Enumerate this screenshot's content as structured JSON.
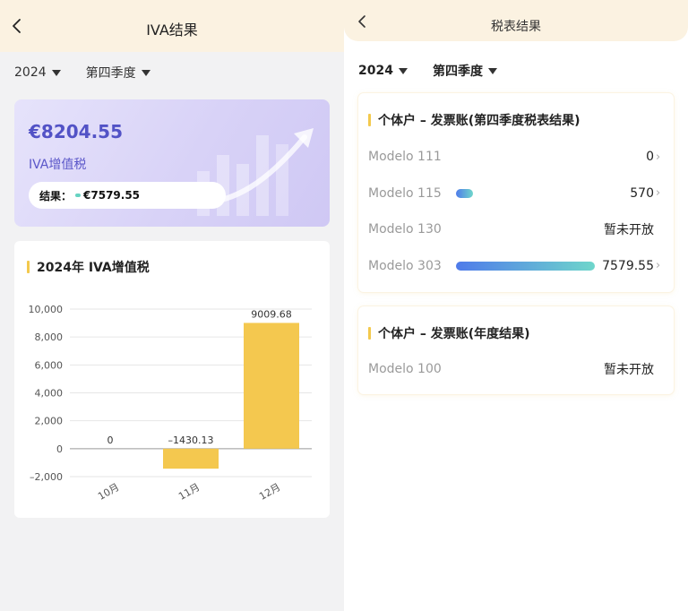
{
  "left": {
    "title": "IVA结果",
    "year": "2024",
    "quarter": "第四季度",
    "summary": {
      "amount": "€8204.55",
      "label": "IVA增值税",
      "result_label": "结果：",
      "result_value": "€7579.55"
    },
    "chart_section_title": "2024年 IVA增值税"
  },
  "chart_data": {
    "type": "bar",
    "categories": [
      "10月",
      "11月",
      "12月"
    ],
    "values": [
      0,
      -1430.13,
      9009.68
    ],
    "value_labels": [
      "0",
      "–1430.13",
      "9009.68"
    ],
    "yticks": [
      10000,
      8000,
      6000,
      4000,
      2000,
      0,
      -2000
    ],
    "ytick_labels": [
      "10,000",
      "8,000",
      "6,000",
      "4,000",
      "2,000",
      "0",
      "–2,000"
    ],
    "ylim": [
      -2000,
      10000
    ],
    "bar_color": "#f4c84f",
    "grid": true,
    "title": "",
    "xlabel": "",
    "ylabel": ""
  },
  "right": {
    "title": "税表结果",
    "year": "2024",
    "quarter": "第四季度",
    "quarterly_card": {
      "title": "个体户 – 发票账(第四季度税表结果)",
      "rows": [
        {
          "label": "Modelo 111",
          "value": "0",
          "fraction": 0,
          "chevron": true
        },
        {
          "label": "Modelo 115",
          "value": "570",
          "fraction": 0.075,
          "chevron": true
        },
        {
          "label": "Modelo 130",
          "value": "暂未开放",
          "fraction": 0,
          "chevron": false
        },
        {
          "label": "Modelo 303",
          "value": "7579.55",
          "fraction": 1,
          "chevron": true
        }
      ]
    },
    "annual_card": {
      "title": "个体户 – 发票账(年度结果)",
      "rows": [
        {
          "label": "Modelo 100",
          "value": "暂未开放",
          "chevron": false
        }
      ]
    }
  },
  "colors": {
    "header_bg": "#fbf2e1",
    "accent_purple": "#5252c6",
    "accent_yellow": "#f3c94d",
    "bar_gradient_start": "#4f7bea",
    "bar_gradient_end": "#6fd6cb"
  }
}
